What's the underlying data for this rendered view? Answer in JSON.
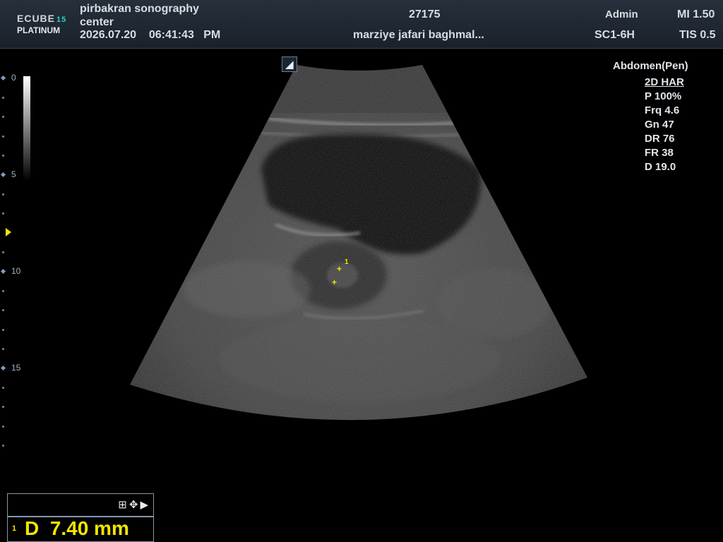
{
  "header": {
    "logo_line1": "ECUBE",
    "logo_line1_num": "15",
    "logo_line2": "PLATINUM",
    "hospital": "pirbakran sonography center",
    "date": "2026.07.20",
    "time": "06:41:43",
    "ampm": "PM",
    "patient_id": "27175",
    "patient_name": "marziye jafari baghmal...",
    "operator": "Admin",
    "probe": "SC1-6H",
    "mi": "MI 1.50",
    "tis": "TIS 0.5"
  },
  "depth_scale": {
    "labels": [
      "0",
      "5",
      "10",
      "15"
    ]
  },
  "orientation_marker": "◢",
  "parameters": {
    "preset": "Abdomen(Pen)",
    "mode": "2D HAR",
    "items": [
      "P 100%",
      "Frq 4.6",
      "Gn 47",
      "DR 76",
      "FR 38",
      "D 19.0"
    ]
  },
  "measurement": {
    "index": "1",
    "text": "D  7.40 mm",
    "caliper_label": "1"
  },
  "colors": {
    "caliper": "#f2e500",
    "header_bg": "#1f2731",
    "text": "#d9dde2"
  }
}
